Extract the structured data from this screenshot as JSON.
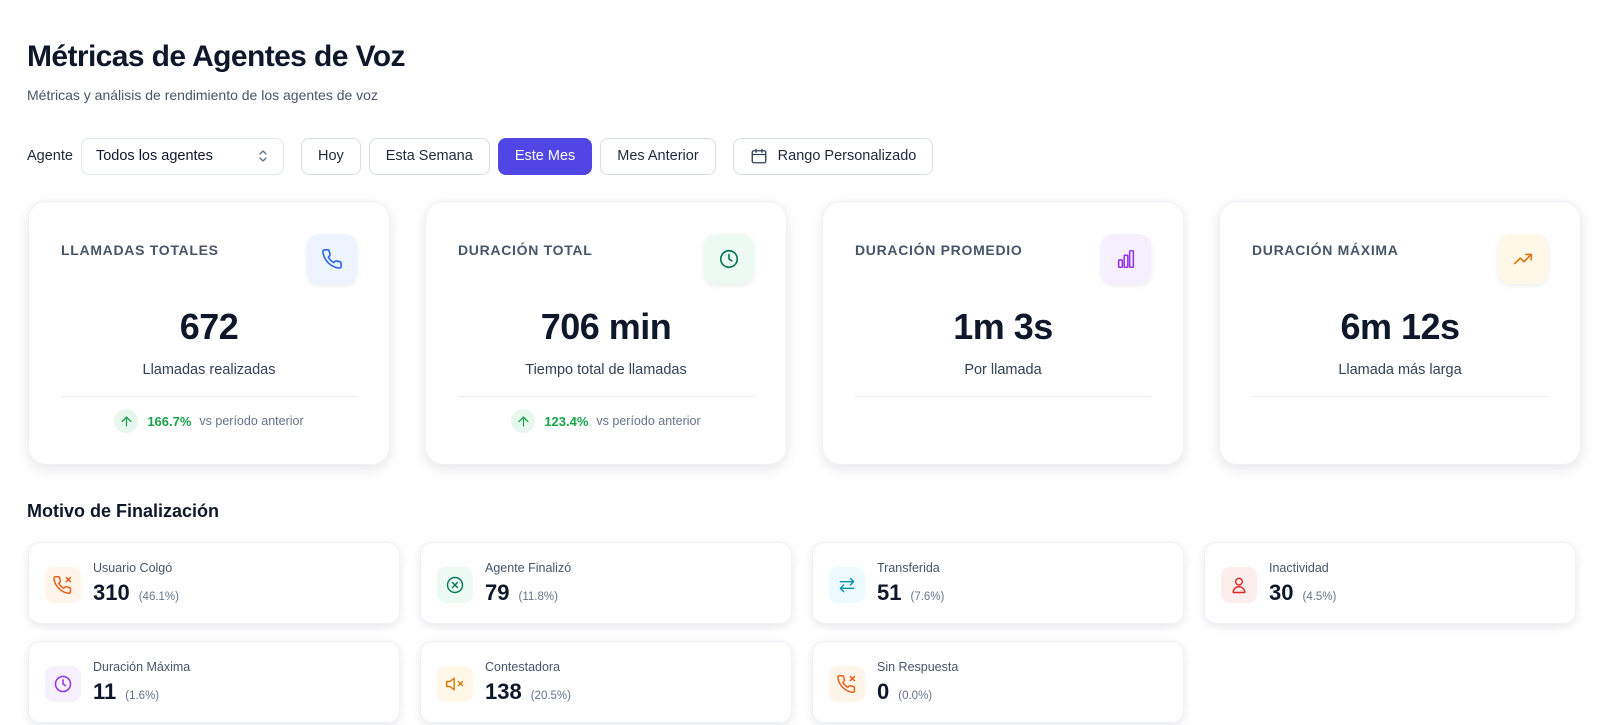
{
  "header": {
    "title": "Métricas de Agentes de Voz",
    "subtitle": "Métricas y análisis de rendimiento de los agentes de voz"
  },
  "filters": {
    "agent_label": "Agente",
    "agent_selected": "Todos los agentes",
    "periods": [
      "Hoy",
      "Esta Semana",
      "Este Mes",
      "Mes Anterior"
    ],
    "active_period": "Este Mes",
    "custom_range": "Rango Personalizado"
  },
  "accent_color": "#4f46e5",
  "stats": [
    {
      "label": "LLAMADAS TOTALES",
      "value": "672",
      "desc": "Llamadas realizadas",
      "trend_pct": "166.7%",
      "trend_text": "vs período anterior",
      "icon": "phone-icon",
      "color": "#2563eb",
      "bg": "#eef4ff"
    },
    {
      "label": "DURACIÓN TOTAL",
      "value": "706 min",
      "desc": "Tiempo total de llamadas",
      "trend_pct": "123.4%",
      "trend_text": "vs período anterior",
      "icon": "clock-icon",
      "color": "#047857",
      "bg": "#ecfaf3"
    },
    {
      "label": "DURACIÓN PROMEDIO",
      "value": "1m 3s",
      "desc": "Por llamada",
      "icon": "bar-chart-icon",
      "color": "#9333ea",
      "bg": "#f6effe"
    },
    {
      "label": "DURACIÓN MÁXIMA",
      "value": "6m 12s",
      "desc": "Llamada más larga",
      "icon": "trending-up-icon",
      "color": "#d97706",
      "bg": "#fff8e8"
    }
  ],
  "reasons_section": {
    "title": "Motivo de Finalización",
    "items": [
      {
        "label": "Usuario Colgó",
        "value": "310",
        "pct": "(46.1%)",
        "icon": "phone-x-icon",
        "color": "#ea580c",
        "bg": "#fff5ea"
      },
      {
        "label": "Agente Finalizó",
        "value": "79",
        "pct": "(11.8%)",
        "icon": "circle-x-icon",
        "color": "#047857",
        "bg": "#ecfaf3"
      },
      {
        "label": "Transferida",
        "value": "51",
        "pct": "(7.6%)",
        "icon": "transfer-arrows-icon",
        "color": "#0891b2",
        "bg": "#ecfbfe"
      },
      {
        "label": "Inactividad",
        "value": "30",
        "pct": "(4.5%)",
        "icon": "user-icon",
        "color": "#dc2626",
        "bg": "#fdeeee"
      },
      {
        "label": "Duración Máxima",
        "value": "11",
        "pct": "(1.6%)",
        "icon": "clock-icon",
        "color": "#9333ea",
        "bg": "#f6effe"
      },
      {
        "label": "Contestadora",
        "value": "138",
        "pct": "(20.5%)",
        "icon": "speaker-muted-icon",
        "color": "#d97706",
        "bg": "#fff8e8"
      },
      {
        "label": "Sin Respuesta",
        "value": "0",
        "pct": "(0.0%)",
        "icon": "phone-x-icon",
        "color": "#ea580c",
        "bg": "#fff5ea"
      }
    ]
  }
}
